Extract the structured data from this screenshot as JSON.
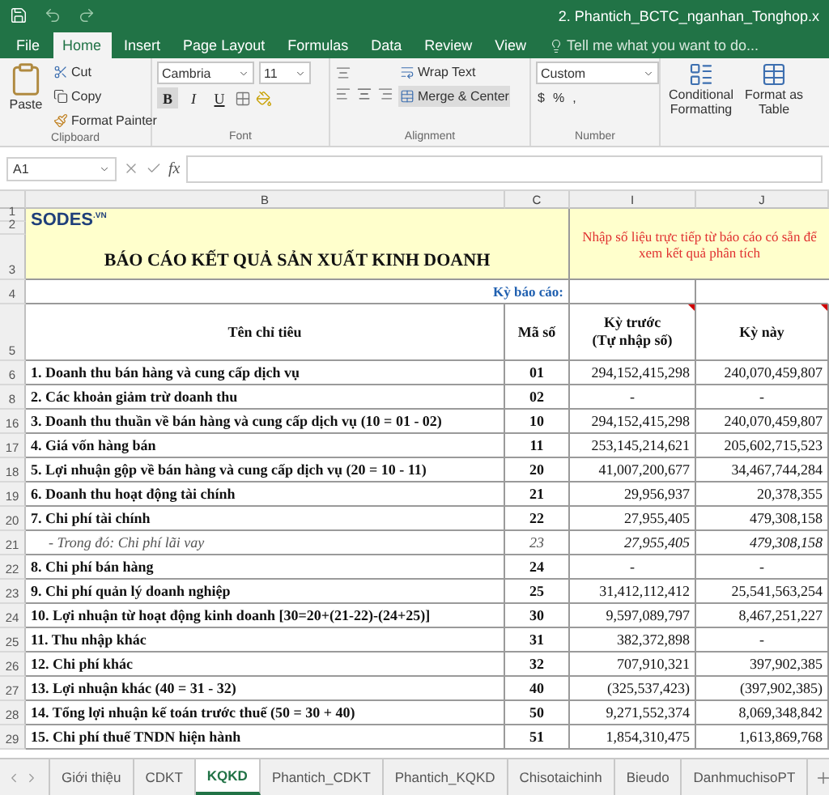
{
  "window": {
    "title": "2. Phantich_BCTC_nganhan_Tonghop.x"
  },
  "ribbon_tabs": [
    {
      "label": "File",
      "selected": false
    },
    {
      "label": "Home",
      "selected": true
    },
    {
      "label": "Insert",
      "selected": false
    },
    {
      "label": "Page Layout",
      "selected": false
    },
    {
      "label": "Formulas",
      "selected": false
    },
    {
      "label": "Data",
      "selected": false
    },
    {
      "label": "Review",
      "selected": false
    },
    {
      "label": "View",
      "selected": false
    }
  ],
  "tell_me": {
    "placeholder": "Tell me what you want to do..."
  },
  "clipboard": {
    "paste": "Paste",
    "cut": "Cut",
    "copy": "Copy",
    "format_painter": "Format Painter",
    "group": "Clipboard"
  },
  "font": {
    "name": "Cambria",
    "size": "11",
    "bold": "B",
    "italic": "I",
    "underline": "U",
    "group": "Font"
  },
  "alignment": {
    "wrap_text": "Wrap Text",
    "merge": "Merge & Center",
    "group": "Alignment"
  },
  "number": {
    "format": "Custom",
    "currency": "$",
    "percent": "%",
    "comma": ",",
    "group": "Number"
  },
  "styles": [
    {
      "line1": "Conditional",
      "line2": "Formatting"
    },
    {
      "line1": "Format as",
      "line2": "Table"
    }
  ],
  "formula_bar": {
    "name_box": "A1",
    "fx": "fx"
  },
  "columns": [
    "B",
    "C",
    "I",
    "J"
  ],
  "header_rows": [
    "1",
    "2",
    "3",
    "4",
    "5"
  ],
  "sheet": {
    "logo": "SODES$^{.VN}$",
    "title": "BÁO CÁO KẾT QUẢ SẢN XUẤT KINH DOANH",
    "note": "Nhập số liệu trực tiếp từ báo cáo có sẵn để xem kết quả phân tích",
    "period_label": "Kỳ báo cáo:",
    "col_name": "Tên chỉ tiêu",
    "col_code": "Mã số",
    "col_prev": "Kỳ trước",
    "col_prev_note": "(Tự nhập số)",
    "col_curr": "Kỳ này"
  },
  "rows": [
    {
      "num": "6",
      "name": "1. Doanh thu bán hàng và cung cấp dịch vụ",
      "code": "01",
      "prev": "294,152,415,298",
      "curr": "240,070,459,807",
      "kind": "item"
    },
    {
      "num": "8",
      "name": "2. Các khoản giảm trừ doanh thu",
      "code": "02",
      "prev": "-",
      "curr": "-",
      "kind": "item"
    },
    {
      "num": "16",
      "name": "3. Doanh thu thuần về bán hàng và cung cấp dịch vụ (10 = 01 - 02)",
      "code": "10",
      "prev": "294,152,415,298",
      "curr": "240,070,459,807",
      "kind": "item"
    },
    {
      "num": "17",
      "name": "4. Giá vốn hàng bán",
      "code": "11",
      "prev": "253,145,214,621",
      "curr": "205,602,715,523",
      "kind": "item"
    },
    {
      "num": "18",
      "name": "5. Lợi nhuận gộp về bán hàng và cung cấp dịch vụ (20 = 10 - 11)",
      "code": "20",
      "prev": "41,007,200,677",
      "curr": "34,467,744,284",
      "kind": "item"
    },
    {
      "num": "19",
      "name": "6. Doanh thu hoạt động tài chính",
      "code": "21",
      "prev": "29,956,937",
      "curr": "20,378,355",
      "kind": "item"
    },
    {
      "num": "20",
      "name": "7. Chi phí tài chính",
      "code": "22",
      "prev": "27,955,405",
      "curr": "479,308,158",
      "kind": "item"
    },
    {
      "num": "21",
      "name": "- Trong đó: Chi phí lãi vay",
      "code": "23",
      "prev": "27,955,405",
      "curr": "479,308,158",
      "kind": "sub"
    },
    {
      "num": "22",
      "name": "8. Chi phí bán hàng",
      "code": "24",
      "prev": "-",
      "curr": "-",
      "kind": "item"
    },
    {
      "num": "23",
      "name": "9. Chi phí quản lý doanh nghiệp",
      "code": "25",
      "prev": "31,412,112,412",
      "curr": "25,541,563,254",
      "kind": "item"
    },
    {
      "num": "24",
      "name": "10. Lợi nhuận từ hoạt động kinh doanh [30=20+(21-22)-(24+25)]",
      "code": "30",
      "prev": "9,597,089,797",
      "curr": "8,467,251,227",
      "kind": "item"
    },
    {
      "num": "25",
      "name": "11. Thu nhập khác",
      "code": "31",
      "prev": "382,372,898",
      "curr": "-",
      "kind": "item"
    },
    {
      "num": "26",
      "name": "12. Chi phí khác",
      "code": "32",
      "prev": "707,910,321",
      "curr": "397,902,385",
      "kind": "item"
    },
    {
      "num": "27",
      "name": "13. Lợi nhuận khác (40 = 31 - 32)",
      "code": "40",
      "prev": "(325,537,423)",
      "curr": "(397,902,385)",
      "kind": "item"
    },
    {
      "num": "28",
      "name": "14. Tổng lợi nhuận kế toán trước thuế (50 = 30 + 40)",
      "code": "50",
      "prev": "9,271,552,374",
      "curr": "8,069,348,842",
      "kind": "item"
    },
    {
      "num": "29",
      "name": "15. Chi phí thuế TNDN hiện hành",
      "code": "51",
      "prev": "1,854,310,475",
      "curr": "1,613,869,768",
      "kind": "item"
    }
  ],
  "sheet_tabs": [
    {
      "label": "Giới thiệu",
      "selected": false
    },
    {
      "label": "CDKT",
      "selected": false
    },
    {
      "label": "KQKD",
      "selected": true
    },
    {
      "label": "Phantich_CDKT",
      "selected": false
    },
    {
      "label": "Phantich_KQKD",
      "selected": false
    },
    {
      "label": "Chisotaichinh",
      "selected": false
    },
    {
      "label": "Bieudo",
      "selected": false
    },
    {
      "label": "DanhmuchisoPT",
      "selected": false
    }
  ]
}
